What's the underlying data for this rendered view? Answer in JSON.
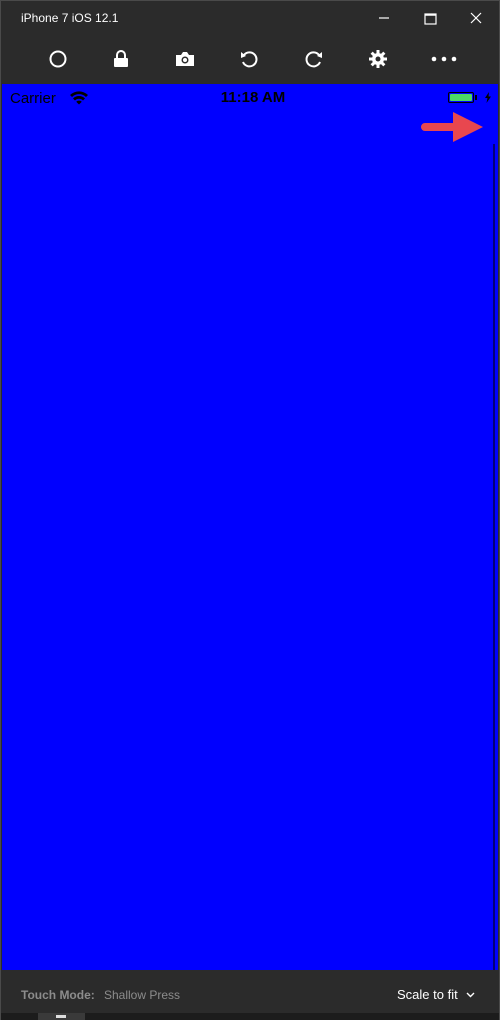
{
  "window": {
    "title": "iPhone 7 iOS 12.1",
    "controls": [
      "minimize-icon",
      "maximize-icon",
      "close-icon"
    ]
  },
  "toolbar": {
    "buttons": [
      {
        "name": "home-button",
        "icon": "circle-icon"
      },
      {
        "name": "lock-button",
        "icon": "lock-icon"
      },
      {
        "name": "screenshot-button",
        "icon": "camera-icon"
      },
      {
        "name": "rotate-left-button",
        "icon": "rotate-left-icon"
      },
      {
        "name": "rotate-right-button",
        "icon": "rotate-right-icon"
      },
      {
        "name": "settings-button",
        "icon": "gear-icon"
      },
      {
        "name": "more-button",
        "icon": "more-dots-icon"
      }
    ]
  },
  "device": {
    "carrier": "Carrier",
    "time": "11:18 AM",
    "battery_level": 1.0,
    "screen_background": "#0000ff",
    "battery_color": "#4cd964"
  },
  "annotation": {
    "arrow_color": "#e8474f",
    "icon": "right-arrow-icon"
  },
  "footer": {
    "touch_mode_label": "Touch Mode:",
    "touch_mode_value": "Shallow Press",
    "scale_label": "Scale to fit"
  }
}
